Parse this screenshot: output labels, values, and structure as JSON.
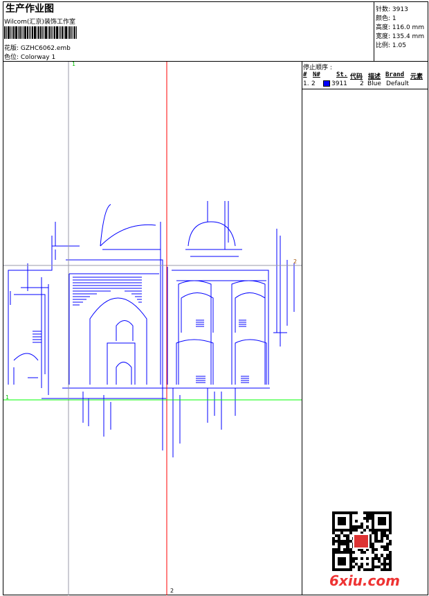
{
  "header": {
    "title": "生产作业图",
    "company": "Wilcom(汇京)装饰工作室",
    "design_label": "花版:",
    "design_value": "GZHC6062.emb",
    "colorway_label": "色位:",
    "colorway_value": "Colorway 1"
  },
  "stats": [
    {
      "label": "针数:",
      "value": "3913"
    },
    {
      "label": "颜色:",
      "value": "1"
    },
    {
      "label": "高度:",
      "value": "116.0 mm"
    },
    {
      "label": "宽度:",
      "value": "135.4 mm"
    },
    {
      "label": "比例:",
      "value": "1.05"
    }
  ],
  "stop_sequence": {
    "title": "停止顺序 :",
    "columns": [
      "#",
      "N#",
      "St.",
      "代码",
      "描述",
      "Brand",
      "元素"
    ],
    "rows": [
      {
        "index": "1.",
        "needle": "2",
        "color": "#0000ff",
        "stitches": "3911",
        "code": "2",
        "description": "Blue",
        "brand": "Default"
      }
    ]
  },
  "guides": {
    "v1_label": "1",
    "h1_label": "1",
    "v2_label": "2",
    "h2_label": "2"
  },
  "watermark": "6xiu.com",
  "colors": {
    "stitch": "#0000ff",
    "guide_red": "#ff0000",
    "guide_green": "#00ff00",
    "guide_grey": "#9a9aa8"
  }
}
